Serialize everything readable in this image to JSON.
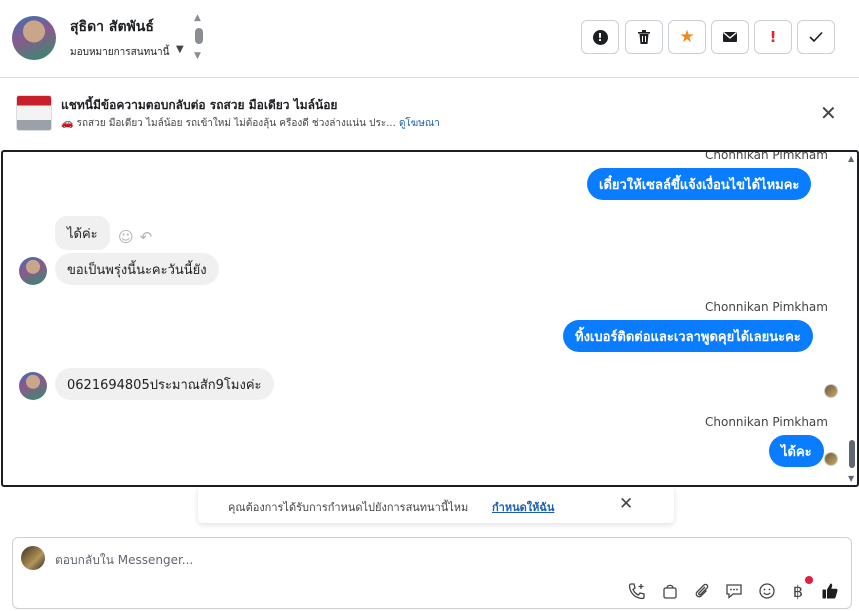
{
  "header": {
    "contact_name": "สุธิดา สัตพันธ์",
    "assign_label": "มอบหมายการสนทนานี้",
    "buttons": [
      {
        "icon": "alert-circle-icon"
      },
      {
        "icon": "trash-icon"
      },
      {
        "icon": "star-icon",
        "color": "#f08a24"
      },
      {
        "icon": "envelope-icon"
      },
      {
        "icon": "exclamation-icon",
        "color": "#e41e3f"
      },
      {
        "icon": "checkmark-icon"
      }
    ]
  },
  "ad": {
    "title": "แชทนี้มีข้อความตอบกลับต่อ รถสวย มือเดียว ไมล์น้อย",
    "subtitle": "🚗 รถสวย มือเดียว ไมล์น้อย รถเข้าใหม่ ไม่ต้องลุ้น ครืองดี ช่วงล่างแน่น ประ...",
    "link": "ดูโฆษณา"
  },
  "messages": {
    "m1_sender": "Chonnikan Pimkham",
    "m1_text": "เดี๋ยวให้เซลล์ขึ้แจ้งเงื่อนไขได้ไหมคะ",
    "m2_text": "ได้ค่ะ",
    "m3_text": "ขอเป็นพรุ่งนี้นะคะวันนี้ยัง",
    "m4_sender": "Chonnikan Pimkham",
    "m4_text": "ทิ้งเบอร์ติดต่อและเวลาพูดคุยได้เลยนะคะ",
    "m5_text": "0621694805ประมาณสัก9โมงค่ะ",
    "m6_sender": "Chonnikan Pimkham",
    "m6_text": "ได้คะ"
  },
  "prompt": {
    "text": "คุณต้องการได้รับการกำหนดไปยังการสนทนานี้ไหม",
    "link": "กำหนดให้ฉัน"
  },
  "composer": {
    "placeholder": "ตอบกลับใน Messenger...",
    "currency_symbol": "฿"
  },
  "colors": {
    "accent": "#0a7cff",
    "incoming_bubble": "#f0f0f0",
    "link": "#1a5fb4",
    "notification": "#e41e3f"
  }
}
